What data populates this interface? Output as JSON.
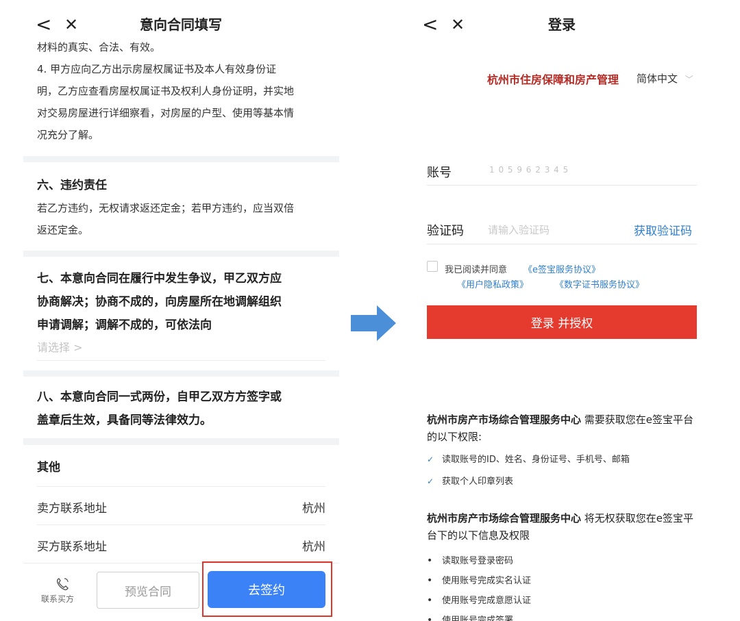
{
  "left": {
    "nav": {
      "back_glyph": "<",
      "close_glyph": "✕",
      "title": "意向合同填写"
    },
    "clause_text": [
      "材料的真实、合法、有效。",
      "4. 甲方应向乙方出示房屋权属证书及本人有效身份证",
      "明，乙方应查看房屋权属证书及权利人身份证明，并实地",
      "对交易房屋进行详细察看，对房屋的户型、使用等基本情",
      "况充分了解。"
    ],
    "section6": {
      "title": "六、违约责任",
      "lines": [
        "若乙方违约，无权请求返还定金；若甲方违约，应当双倍",
        "返还定金。"
      ]
    },
    "section7": {
      "lines": [
        "七、本意向合同在履行中发生争议，甲乙双方应",
        "协商解决；协商不成的，向房屋所在地调解组织",
        "申请调解；调解不成的，可依法向"
      ],
      "select_placeholder": "请选择 >"
    },
    "section8": {
      "lines": [
        "八、本意向合同一式两份，自甲乙双方方签字或",
        "盖章后生效，具备同等法律效力。"
      ]
    },
    "other": {
      "title": "其他",
      "rows": [
        {
          "label": "卖方联系地址",
          "value": "杭州"
        },
        {
          "label": "买方联系地址",
          "value": "杭州"
        }
      ]
    },
    "bottom": {
      "contact_label": "联系买方",
      "preview_label": "预览合同",
      "sign_label": "去签约"
    }
  },
  "right": {
    "nav": {
      "back_glyph": "<",
      "close_glyph": "✕",
      "title": "登录"
    },
    "org_name": "杭州市住房保障和房产管理",
    "language": "简体中文",
    "account_label": "账号",
    "account_value": "1 0 5 9 6 2 3 4 5",
    "code_label": "验证码",
    "code_placeholder": "请输入验证码",
    "get_code_label": "获取验证码",
    "agree_prefix": "我已阅读并同意",
    "agreements": [
      "《e签宝服务协议》",
      "《用户隐私政策》",
      "《数字证书服务协议》"
    ],
    "login_label": "登录 并授权",
    "perm_block1": {
      "org": "杭州市房产市场综合管理服务中心",
      "text": "需要获取您在e签宝平台的以下权限:",
      "items": [
        "读取账号的ID、姓名、身份证号、手机号、邮箱",
        "获取个人印章列表"
      ]
    },
    "perm_block2": {
      "org": "杭州市房产市场综合管理服务中心",
      "text": "将无权获取您在e签宝平台下的以下信息及权限",
      "items": [
        "读取账号登录密码",
        "使用账号完成实名认证",
        "使用账号完成意愿认证",
        "使用账号完成签署"
      ]
    }
  },
  "colors": {
    "primary_blue": "#3b82f6",
    "login_red": "#e53b2f",
    "link_blue": "#2f7fd0",
    "arrow_blue": "#4a8fd8",
    "highlight_red": "#d9382e"
  },
  "icons": [
    "back-icon",
    "close-icon",
    "phone-icon",
    "chevron-down-icon",
    "checkbox-icon",
    "check-icon",
    "arrow-right-icon"
  ]
}
